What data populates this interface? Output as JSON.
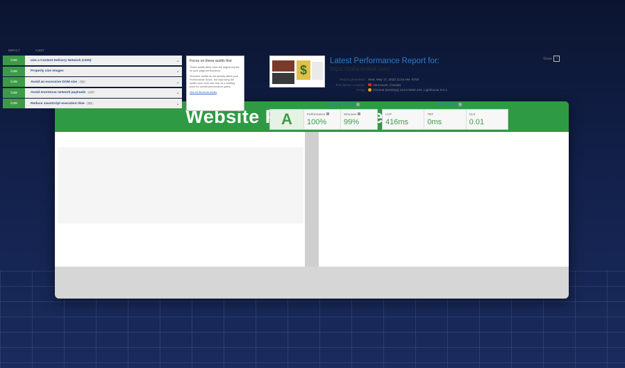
{
  "banner": {
    "title": "Website Performance Audit"
  },
  "audits": {
    "col_impact": "IMPACT",
    "col_audit": "AUDIT",
    "rows": [
      {
        "impact": "Low",
        "label": "Use a Content Delivery Network (CDN)",
        "tag": ""
      },
      {
        "impact": "Low",
        "label": "Properly size images",
        "tag": ""
      },
      {
        "impact": "Low",
        "label": "Avoid an excessive DOM size",
        "tag": "TBT"
      },
      {
        "impact": "Low",
        "label": "Avoid enormous network payloads",
        "tag": "LCP"
      },
      {
        "impact": "Low",
        "label": "Reduce JavaScript execution time",
        "tag": "TBT"
      }
    ],
    "focus": {
      "title": "Focus on these audits first",
      "p1": "These audits likely have the largest impact on your page performance.",
      "p2": "Structure audits do not directly affect your Performance Score, but improving the audits seen here can help as a starting point for overall performance gains.",
      "link": "See all Structure audits"
    }
  },
  "report": {
    "title": "Latest Performance Report for:",
    "url": "https://dollarshekel.com/",
    "share_label": "Share",
    "meta": [
      {
        "key": "Report generated:",
        "value": "Wed, May 17, 2023 11:54 AM -0700"
      },
      {
        "key": "Test Server Location:",
        "value": "Vancouver, Canada"
      },
      {
        "key": "Using:",
        "value": "Chrome (Desktop) 113.0.5060.134, Lighthouse 9.6.4"
      }
    ]
  },
  "grade": {
    "title": "GTmetrix Grade",
    "letter": "A",
    "metrics": [
      {
        "label": "Performance",
        "value": "100%"
      },
      {
        "label": "Structure",
        "value": "99%"
      }
    ]
  },
  "vitals": {
    "title": "Web Vitals",
    "metrics": [
      {
        "label": "LCP",
        "value": "416ms"
      },
      {
        "label": "TBT",
        "value": "0ms"
      },
      {
        "label": "CLS",
        "value": "0.01"
      }
    ]
  },
  "colors": {
    "green": "#2f9a44",
    "blue": "#2b7cc9",
    "bg": "#12204a"
  }
}
